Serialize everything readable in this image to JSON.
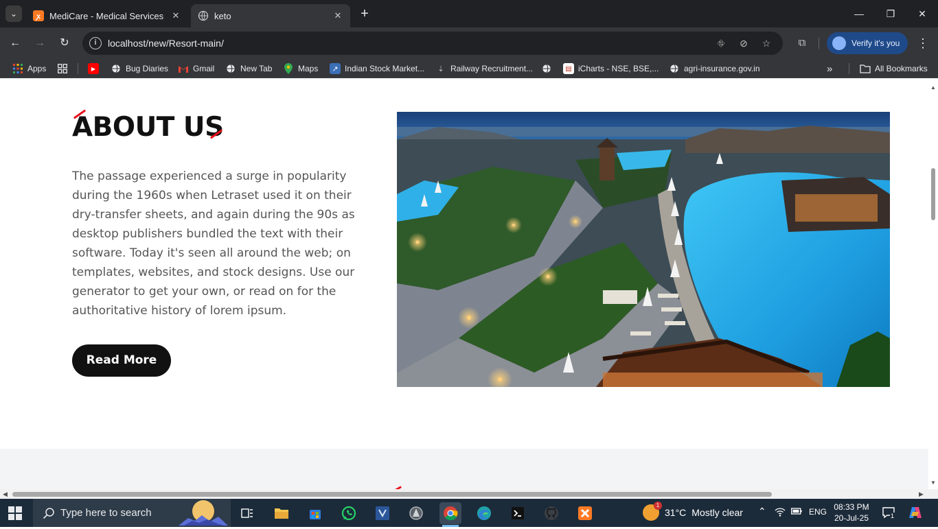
{
  "browser": {
    "tabs": [
      {
        "title": "MediCare - Medical Services",
        "favicon": "xampp-icon",
        "active": false
      },
      {
        "title": "keto",
        "favicon": "globe-icon",
        "active": true
      }
    ],
    "address": {
      "url": "localhost/new/Resort-main/"
    },
    "profile_button": "Verify it's you",
    "bookmarks": [
      {
        "label": "Apps",
        "icon": "apps-grid-icon"
      },
      {
        "label": "",
        "icon": "tab-groups-icon"
      },
      {
        "label": "",
        "icon": "youtube-icon"
      },
      {
        "label": "Bug Diaries",
        "icon": "globe-icon"
      },
      {
        "label": "Gmail",
        "icon": "gmail-icon"
      },
      {
        "label": "New Tab",
        "icon": "globe-icon"
      },
      {
        "label": "Maps",
        "icon": "maps-icon"
      },
      {
        "label": "Indian Stock Market...",
        "icon": "stock-icon"
      },
      {
        "label": "Railway Recruitment...",
        "icon": "railway-icon"
      },
      {
        "label": "",
        "icon": "globe-icon"
      },
      {
        "label": "iCharts - NSE, BSE,...",
        "icon": "icharts-icon"
      },
      {
        "label": "agri-insurance.gov.in",
        "icon": "globe-icon"
      }
    ],
    "all_bookmarks": "All Bookmarks"
  },
  "page": {
    "about": {
      "title": "ABOUT US",
      "body": "The passage experienced a surge in popularity during the 1960s when Letraset used it on their dry-transfer sheets, and again during the 90s as desktop publishers bundled the text with their software. Today it's seen all around the web; on templates, websites, and stock designs. Use our generator to get your own, or read on for the authoritative history of lorem ipsum.",
      "button": "Read More",
      "image": "resort-pool-night-photo"
    },
    "accent_color": "#e8131c"
  },
  "taskbar": {
    "search_placeholder": "Type here to search",
    "apps": [
      "task-view-icon",
      "file-explorer-icon",
      "store-icon",
      "whatsapp-icon",
      "vscode-icon",
      "app-icon",
      "chrome-icon",
      "edge-icon",
      "terminal-icon",
      "github-icon",
      "xampp-icon"
    ],
    "weather": {
      "temp": "31°C",
      "condition": "Mostly clear",
      "badge": "1"
    },
    "language": "ENG",
    "time": "08:33 PM",
    "date": "20-Jul-25",
    "notification_count": "1"
  }
}
